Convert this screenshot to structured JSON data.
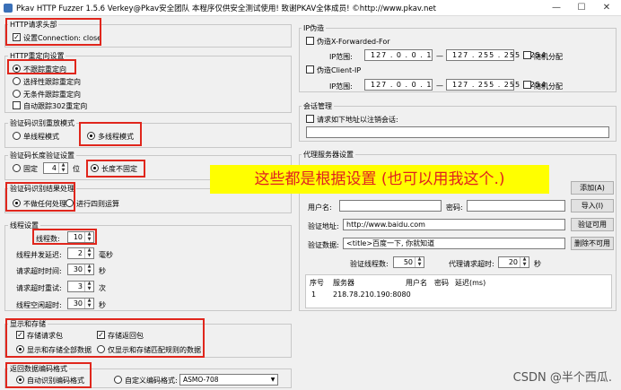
{
  "window": {
    "title": "Pkav HTTP Fuzzer 1.5.6  Verkey@Pkav安全团队  本程序仅供安全测试使用! 致谢PKAV全体成员! ©http://www.pkav.net",
    "min": "—",
    "max": "☐",
    "close": "✕"
  },
  "http_header": {
    "title": "HTTP请求头部",
    "set_connection": "设置Connection: close"
  },
  "redirect": {
    "title": "HTTP重定向设置",
    "no_follow": "不跟踪重定向",
    "selective": "选择性跟踪重定向",
    "unconditional": "无条件跟踪重定向",
    "auto302": "自动跟踪302重定向"
  },
  "captcha_mode": {
    "title": "验证码识别重放模式",
    "single": "单线程模式",
    "multi": "多线程模式"
  },
  "captcha_len": {
    "title": "验证码长度验证设置",
    "fixed": "固定",
    "fixed_val": "4",
    "unit": "位",
    "variable": "长度不固定"
  },
  "captcha_result": {
    "title": "验证码识别结果处理",
    "none": "不做任何处理",
    "four_ops": "进行四则运算"
  },
  "thread": {
    "title": "线程设置",
    "count_label": "线程数:",
    "count_val": "10",
    "concurrency_label": "线程并发延迟:",
    "concurrency_val": "2",
    "concurrency_unit": "毫秒",
    "timeout_label": "请求超时时间:",
    "timeout_val": "30",
    "timeout_unit": "秒",
    "retry_label": "请求超时重试:",
    "retry_val": "3",
    "retry_unit": "次",
    "idle_label": "线程空闲超时:",
    "idle_val": "30",
    "idle_unit": "秒"
  },
  "display": {
    "title": "显示和存储",
    "store_request": "存储请求包",
    "store_response": "存储返回包",
    "show_all": "显示和存储全部数据",
    "show_match": "仅显示和存储匹配规则的数据"
  },
  "encoding": {
    "title": "返回数据编码格式",
    "auto": "自动识别编码格式",
    "custom": "自定义编码格式:",
    "custom_val": "ASMO-708"
  },
  "ip_spoof": {
    "title": "IP伪造",
    "xff": "伪造X-Forwarded-For",
    "range_label": "IP范围:",
    "xff_from": "127 . 0 . 0 . 1",
    "xff_to": "127 . 255 . 255 . 254",
    "random": "随机分配",
    "client_ip": "伪造Client-IP",
    "cip_from": "127 . 0 . 0 . 1",
    "cip_to": "127 . 255 . 255 . 254",
    "random2": "随机分配"
  },
  "session": {
    "title": "会话管理",
    "logout_label": "请求如下地址以注销会话:"
  },
  "proxy": {
    "title": "代理服务器设置",
    "user_label": "用户名:",
    "pass_label": "密码:",
    "add": "添加(A)",
    "import": "导入(I)",
    "verify_label": "验证地址:",
    "verify_url": "http://www.baidu.com",
    "verify_btn": "验证可用",
    "verify_data_label": "验证数据:",
    "verify_data": "<title>百度一下, 你就知道",
    "delete_btn": "删除不可用",
    "threads_label": "验证线程数:",
    "threads_val": "50",
    "timeout_label": "代理请求超时:",
    "timeout_val": "20",
    "timeout_unit": "秒",
    "columns": [
      "序号",
      "服务器",
      "用户名",
      "密码",
      "延迟(ms)"
    ],
    "rows": [
      [
        "1",
        "218.78.210.190:8080",
        "",
        "",
        ""
      ]
    ]
  },
  "annotation": {
    "banner": "这些都是根据设置 (也可以用我这个.)",
    "watermark": "CSDN @半个西瓜."
  },
  "colors": {
    "highlight": "#e0261c",
    "banner_bg": "#ffff00",
    "banner_text": "#e02020"
  }
}
